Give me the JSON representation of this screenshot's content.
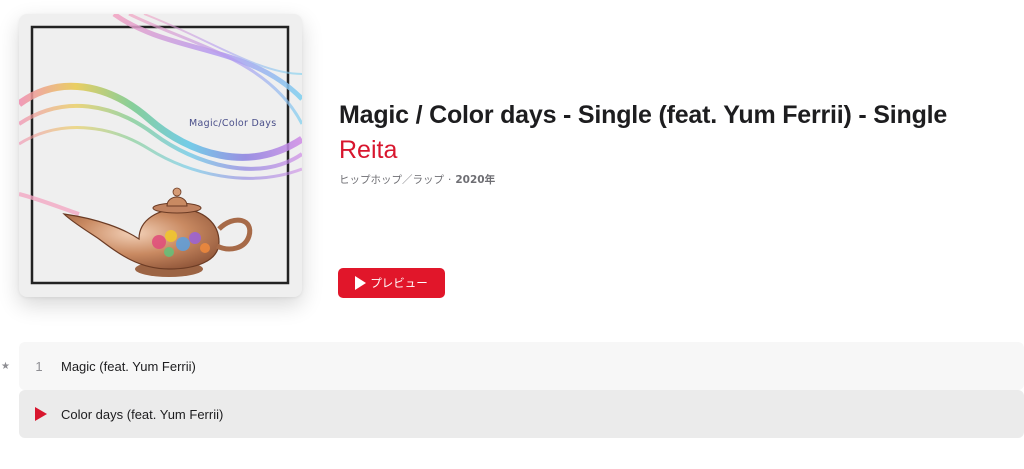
{
  "album": {
    "artwork_caption": "Magic/Color Days",
    "title": "Magic / Color days - Single (feat. Yum Ferrii) - Single",
    "artist": "Reita",
    "genre": "ヒップホップ／ラップ",
    "separator": "·",
    "year": "2020年"
  },
  "preview_button": {
    "label": "プレビュー",
    "icon": "play-icon",
    "color": "#e1162a"
  },
  "tracks": [
    {
      "marker": "★",
      "number": "1",
      "title": "Magic (feat. Yum Ferrii)",
      "playing": false
    },
    {
      "number": "",
      "title": "Color days (feat. Yum Ferrii)",
      "playing": true
    }
  ],
  "colors": {
    "accent": "#d8162e"
  }
}
